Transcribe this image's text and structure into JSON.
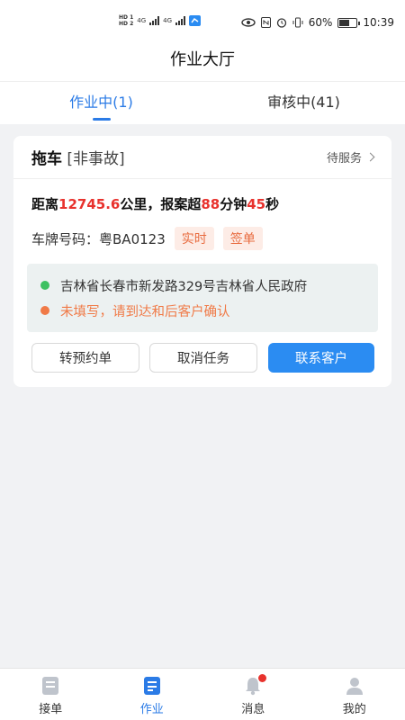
{
  "statusbar": {
    "left_hd1": "HD 1",
    "left_hd2": "HD 2",
    "net": "4G",
    "battery": "60%",
    "time": "10:39"
  },
  "header": {
    "title": "作业大厅"
  },
  "tabs": [
    {
      "label": "作业中(1)",
      "active": true
    },
    {
      "label": "审核中(41)",
      "active": false
    }
  ],
  "card": {
    "type": "拖车",
    "subtype": "[非事故]",
    "status": "待服务",
    "distance_prefix": "距离",
    "distance_value": "12745.6",
    "distance_unit": "公里，报案超",
    "minutes": "88",
    "minutes_unit": "分钟",
    "seconds": "45",
    "seconds_unit": "秒",
    "plate_label": "车牌号码：",
    "plate_value": "粤BA0123",
    "tag1": "实时",
    "tag2": "签单",
    "address_from": "吉林省长春市新发路329号吉林省人民政府",
    "address_to": "未填写，请到达和后客户确认",
    "btn_reserve": "转预约单",
    "btn_cancel": "取消任务",
    "btn_contact": "联系客户"
  },
  "bottom_nav": [
    {
      "label": "接单",
      "icon": "order-icon"
    },
    {
      "label": "作业",
      "icon": "task-icon",
      "active": true
    },
    {
      "label": "消息",
      "icon": "bell-icon",
      "badge": true
    },
    {
      "label": "我的",
      "icon": "user-icon"
    }
  ],
  "colors": {
    "accent": "#2b7be6",
    "red": "#e8322d",
    "orange": "#f07a47",
    "green": "#3cc161"
  }
}
